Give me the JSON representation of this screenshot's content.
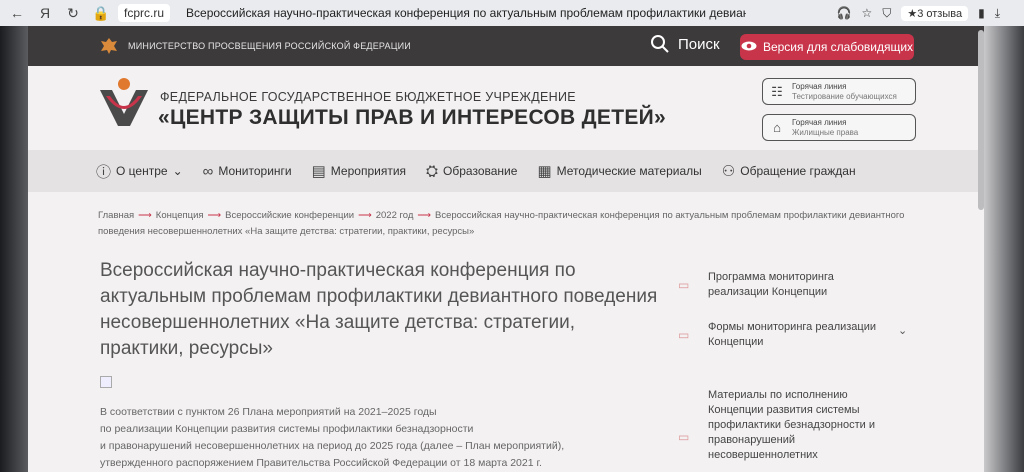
{
  "browser": {
    "url": "fcprc.ru",
    "tab_title": "Всероссийская научно-практическая конференция по актуальным проблемам профилактики девиант...",
    "reviews": "★3 отзыва"
  },
  "topbar": {
    "ministry": "МИНИСТЕРСТВО ПРОСВЕЩЕНИЯ РОССИЙСКОЙ ФЕДЕРАЦИИ",
    "search_label": "Поиск",
    "a11y_label": "Версия для слабовидящих"
  },
  "header": {
    "org_subtitle": "ФЕДЕРАЛЬНОЕ ГОСУДАРСТВЕННОЕ БЮДЖЕТНОЕ УЧРЕЖДЕНИЕ",
    "org_title": "«ЦЕНТР ЗАЩИТЫ ПРАВ И ИНТЕРЕСОВ ДЕТЕЙ»",
    "hotlines": [
      {
        "title": "Горячая линия",
        "subtitle": "Тестирование обучающихся"
      },
      {
        "title": "Горячая линия",
        "subtitle": "Жилищные права"
      }
    ]
  },
  "nav": {
    "items": [
      {
        "label": "О центре",
        "icon": "info-icon"
      },
      {
        "label": "Мониторинги",
        "icon": "binoculars-icon"
      },
      {
        "label": "Мероприятия",
        "icon": "presentation-icon"
      },
      {
        "label": "Образование",
        "icon": "graduation-cap-icon"
      },
      {
        "label": "Методические материалы",
        "icon": "document-icon"
      },
      {
        "label": "Обращение граждан",
        "icon": "people-icon"
      }
    ]
  },
  "breadcrumb": {
    "items": [
      "Главная",
      "Концепция",
      "Всероссийские конференции",
      "2022 год"
    ],
    "current": "Всероссийская научно-практическая конференция по актуальным проблемам профилактики девиантного поведения несовершеннолетних «На защите детства: стратегии, практики, ресурсы»"
  },
  "main": {
    "title": "Всероссийская научно-практическая конференция по актуальным проблемам профилактики девиантного поведения несовершеннолетних «На защите детства: стратегии, практики, ресурсы»",
    "body_lines": [
      "В соответствии с пунктом 26 Плана мероприятий на 2021–2025 годы",
      "по реализации Концепции развития системы профилактики безнадзорности",
      "и правонарушений несовершеннолетних на период до 2025 года (далее – План мероприятий),",
      "утвержденного распоряжением Правительства Российской Федерации от 18 марта 2021 г."
    ]
  },
  "sidebar": {
    "items": [
      {
        "label": "Программа мониторинга реализации Концепции"
      },
      {
        "label": "Формы мониторинга реализации Концепции"
      },
      {
        "label": "Материалы по исполнению Концепции развития системы профилактики безнадзорности и правонарушений несовершеннолетних"
      }
    ]
  },
  "colors": {
    "accent": "#c8344a",
    "topbar": "#3d3a3c",
    "nav_bg": "#e4e2e3"
  }
}
